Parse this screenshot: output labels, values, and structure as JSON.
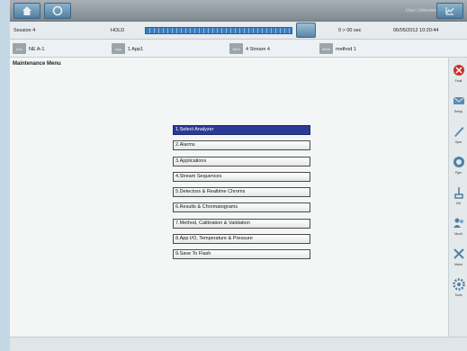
{
  "status": {
    "session": "Session 4",
    "hold": "HOLD",
    "time": "0 > 00 sec",
    "datetime": "06/05/2012 10:20:44"
  },
  "toolbar": {
    "user": "User: Unknown"
  },
  "info": {
    "chip1": "Ann",
    "value1": "NE A-1",
    "chip2": "App",
    "value2": "1 App1",
    "chip3": "Strm",
    "value3": "4 Stream 4",
    "chip4": "Meth",
    "value4": "method 1"
  },
  "menu_title": "Maintenance Menu",
  "menu": {
    "items": [
      "1.Select Analyzer",
      "2.Alarms",
      "3.Applications",
      "4.Stream Sequences",
      "5.Detectors & Realtime Chroms",
      "6.Results & Chromatograms",
      "7.Method, Calibration & Validation",
      "8.App I/O, Temperature & Pressure",
      "9.Save To Flash"
    ]
  },
  "sidebar": {
    "items": [
      "Fault",
      "Setup",
      "Oper",
      "Pgm",
      "Ctrl",
      "Monit",
      "Maint",
      "Tools",
      "Config"
    ]
  }
}
